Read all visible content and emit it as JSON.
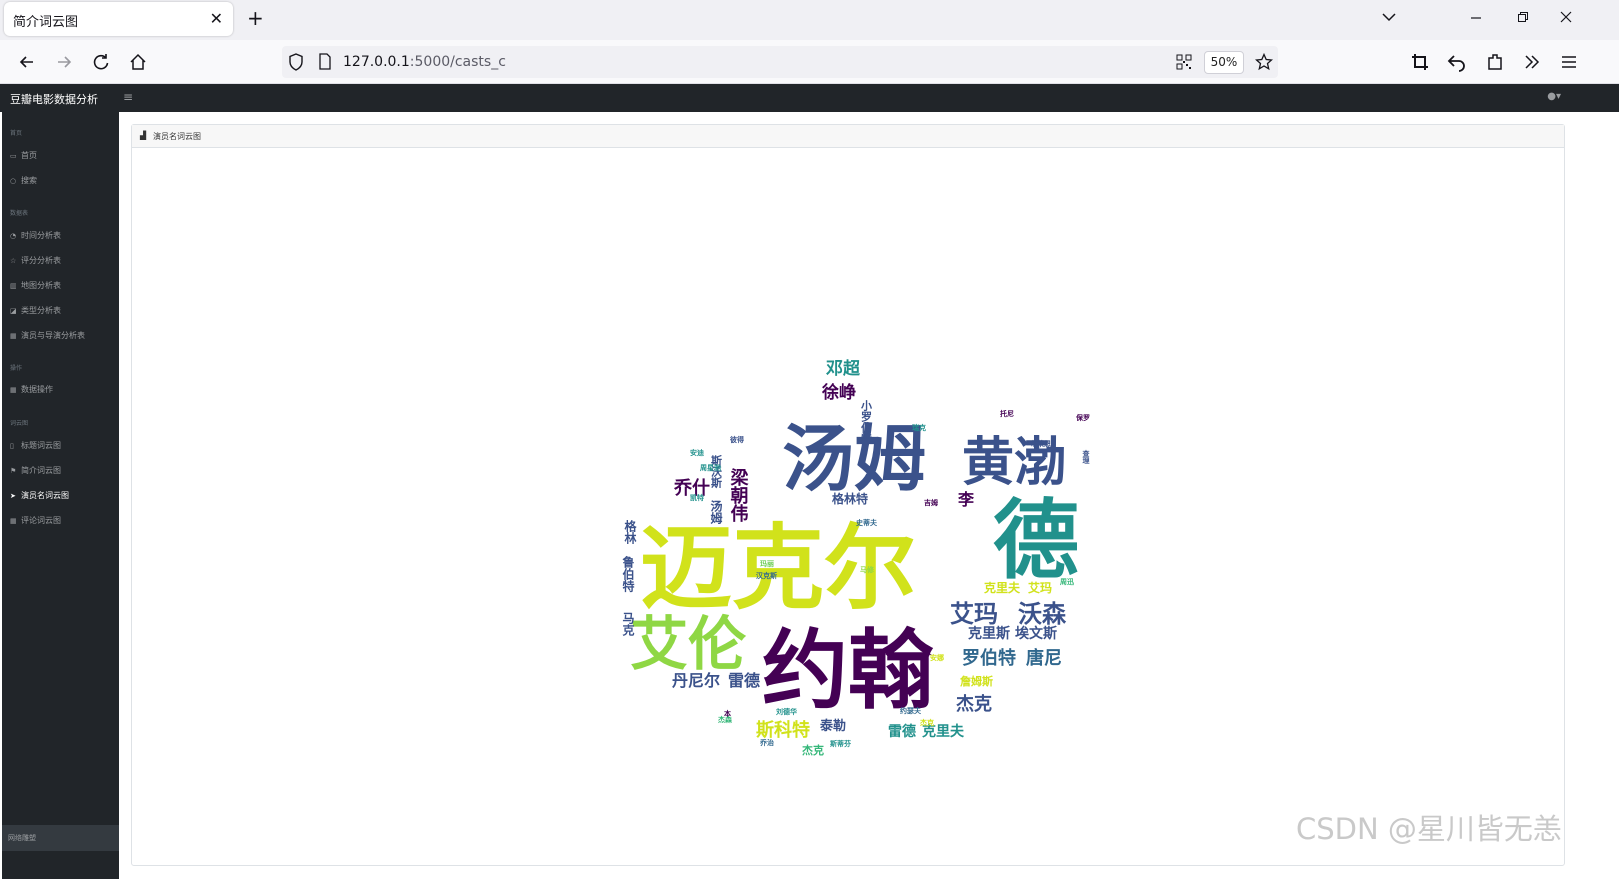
{
  "browser": {
    "tab_title": "简介词云图",
    "tab_close": "✕",
    "new_tab": "+",
    "url_host": "127.0.0.1",
    "url_path": ":5000/casts_c",
    "zoom": "50%"
  },
  "app": {
    "brand": "豆瓣电影数据分析",
    "sidebar": {
      "headings": [
        "首页",
        "数据表",
        "操作",
        "词云图"
      ],
      "items": [
        {
          "label": "首页",
          "icon": "monitor-icon"
        },
        {
          "label": "搜索",
          "icon": "search-icon"
        },
        {
          "label": "时间分析表",
          "icon": "clock-icon"
        },
        {
          "label": "评分分析表",
          "icon": "star-icon"
        },
        {
          "label": "地图分析表",
          "icon": "map-icon"
        },
        {
          "label": "类型分析表",
          "icon": "tag-icon"
        },
        {
          "label": "演员与导演分析表",
          "icon": "table-icon"
        },
        {
          "label": "数据操作",
          "icon": "table-icon"
        },
        {
          "label": "标题词云图",
          "icon": "doc-icon"
        },
        {
          "label": "简介词云图",
          "icon": "flag-icon"
        },
        {
          "label": "演员名词云图",
          "icon": "send-icon",
          "active": true
        },
        {
          "label": "评论词云图",
          "icon": "table-icon"
        }
      ],
      "footer": "网络雕塑"
    },
    "card_title": "演员名词云图"
  },
  "wordcloud": {
    "colors": {
      "yellow": "#d1e21b",
      "green": "#8fd744",
      "teal": "#21918c",
      "blue": "#3b528b",
      "purple": "#440154",
      "navy": "#31688e",
      "lime": "#6ece58",
      "cyan": "#35b779"
    },
    "words": [
      {
        "text": "迈克尔",
        "color": "yellow",
        "size": 92
      },
      {
        "text": "约翰",
        "color": "purple",
        "size": 86
      },
      {
        "text": "汤姆",
        "color": "blue",
        "size": 72
      },
      {
        "text": "德",
        "color": "teal",
        "size": 86
      },
      {
        "text": "黄渤",
        "color": "blue",
        "size": 52
      },
      {
        "text": "艾伦",
        "color": "green",
        "size": 58
      },
      {
        "text": "艾玛",
        "color": "blue",
        "size": 24
      },
      {
        "text": "沃森",
        "color": "blue",
        "size": 24
      },
      {
        "text": "罗伯特",
        "color": "navy",
        "size": 18
      },
      {
        "text": "唐尼",
        "color": "navy",
        "size": 18
      },
      {
        "text": "克里斯",
        "color": "blue",
        "size": 14
      },
      {
        "text": "埃文斯",
        "color": "blue",
        "size": 14
      },
      {
        "text": "丹尼尔",
        "color": "blue",
        "size": 16
      },
      {
        "text": "雷德",
        "color": "blue",
        "size": 16
      },
      {
        "text": "杰克",
        "color": "blue",
        "size": 18
      },
      {
        "text": "斯科特",
        "color": "yellow",
        "size": 18
      },
      {
        "text": "泰勒",
        "color": "blue",
        "size": 13
      },
      {
        "text": "雷德",
        "color": "teal",
        "size": 14
      },
      {
        "text": "克里夫",
        "color": "teal",
        "size": 14
      },
      {
        "text": "乔什",
        "color": "purple",
        "size": 18
      },
      {
        "text": "梁朝伟",
        "color": "purple",
        "size": 18
      },
      {
        "text": "徐峥",
        "color": "purple",
        "size": 17
      },
      {
        "text": "邓超",
        "color": "teal",
        "size": 17
      },
      {
        "text": "格林特",
        "color": "blue",
        "size": 12
      },
      {
        "text": "李",
        "color": "purple",
        "size": 16
      },
      {
        "text": "克里夫",
        "color": "yellow",
        "size": 12
      },
      {
        "text": "艾玛",
        "color": "yellow",
        "size": 12
      },
      {
        "text": "詹姆斯",
        "color": "yellow",
        "size": 11
      },
      {
        "text": "杰克",
        "color": "cyan",
        "size": 11
      },
      {
        "text": "马克",
        "color": "blue",
        "size": 12
      },
      {
        "text": "鲁伯特",
        "color": "blue",
        "size": 12
      },
      {
        "text": "格林",
        "color": "blue",
        "size": 12
      },
      {
        "text": "汤姆",
        "color": "blue",
        "size": 12
      },
      {
        "text": "斯沃斯",
        "color": "blue",
        "size": 11
      },
      {
        "text": "小罗伯特",
        "color": "blue",
        "size": 11
      },
      {
        "text": "安迪",
        "color": "teal",
        "size": 7
      },
      {
        "text": "彼得",
        "color": "blue",
        "size": 7
      },
      {
        "text": "瑞克",
        "color": "teal",
        "size": 7
      },
      {
        "text": "史蒂夫",
        "color": "navy",
        "size": 7
      },
      {
        "text": "凯特",
        "color": "teal",
        "size": 7
      },
      {
        "text": "吉姆",
        "color": "purple",
        "size": 7
      },
      {
        "text": "周星驰",
        "color": "teal",
        "size": 7
      },
      {
        "text": "马修",
        "color": "green",
        "size": 7
      },
      {
        "text": "乔治",
        "color": "navy",
        "size": 7
      },
      {
        "text": "本",
        "color": "purple",
        "size": 7
      },
      {
        "text": "杰森",
        "color": "cyan",
        "size": 7
      },
      {
        "text": "约瑟夫",
        "color": "navy",
        "size": 7
      },
      {
        "text": "安娜",
        "color": "yellow",
        "size": 7
      },
      {
        "text": "刘德华",
        "color": "teal",
        "size": 7
      },
      {
        "text": "保罗",
        "color": "purple",
        "size": 7
      },
      {
        "text": "布莱恩",
        "color": "blue",
        "size": 7
      },
      {
        "text": "玛丽",
        "color": "lime",
        "size": 7
      },
      {
        "text": "汉克斯",
        "color": "navy",
        "size": 7
      },
      {
        "text": "斯蒂芬",
        "color": "teal",
        "size": 7
      },
      {
        "text": "杰克",
        "color": "yellow",
        "size": 7
      },
      {
        "text": "周迅",
        "color": "cyan",
        "size": 7
      },
      {
        "text": "查理",
        "color": "blue",
        "size": 7
      },
      {
        "text": "托尼",
        "color": "purple",
        "size": 7
      }
    ]
  },
  "watermark": "CSDN @星川皆无恙"
}
